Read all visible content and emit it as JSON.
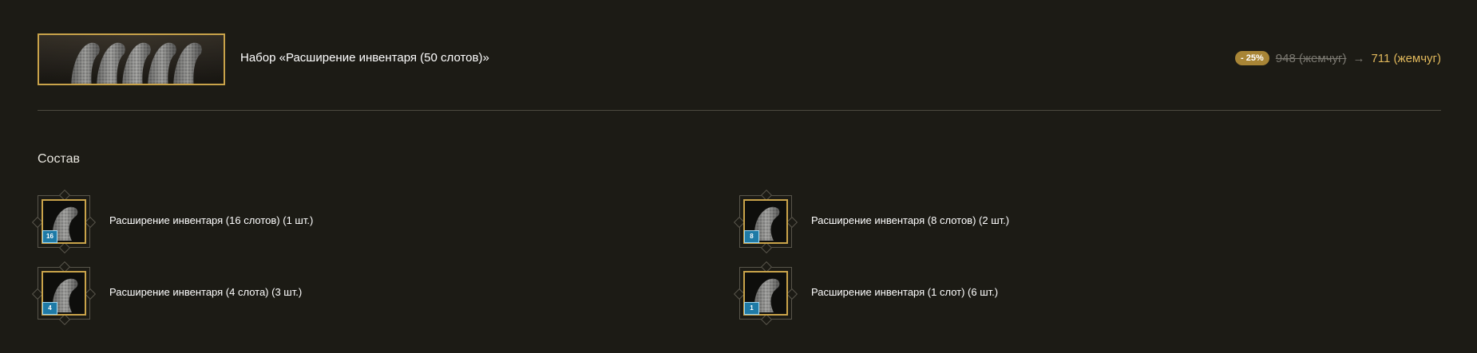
{
  "header": {
    "title": "Набор «Расширение инвентаря (50 слотов)»",
    "banner_icon": "inventory-bags-banner",
    "price": {
      "discount": "- 25%",
      "old": "948 (жемчуг)",
      "arrow": "→",
      "new": "711 (жемчуг)"
    }
  },
  "composition": {
    "title": "Состав",
    "items": [
      {
        "label": "Расширение инвентаря (16 слотов) (1 шт.)",
        "badge": "16",
        "icon": "inventory-bag-icon"
      },
      {
        "label": "Расширение инвентаря (8 слотов) (2 шт.)",
        "badge": "8",
        "icon": "inventory-bag-icon"
      },
      {
        "label": "Расширение инвентаря (4 слота) (3 шт.)",
        "badge": "4",
        "icon": "inventory-bag-icon"
      },
      {
        "label": "Расширение инвентаря (1 слот) (6 шт.)",
        "badge": "1",
        "icon": "inventory-bag-icon"
      }
    ]
  },
  "colors": {
    "background": "#1c1b15",
    "gold_border": "#c9a34a",
    "discount_badge": "#a88536",
    "new_price": "#e0b85c",
    "old_price": "#7c7a72",
    "slot_badge": "#1e7aa6"
  }
}
